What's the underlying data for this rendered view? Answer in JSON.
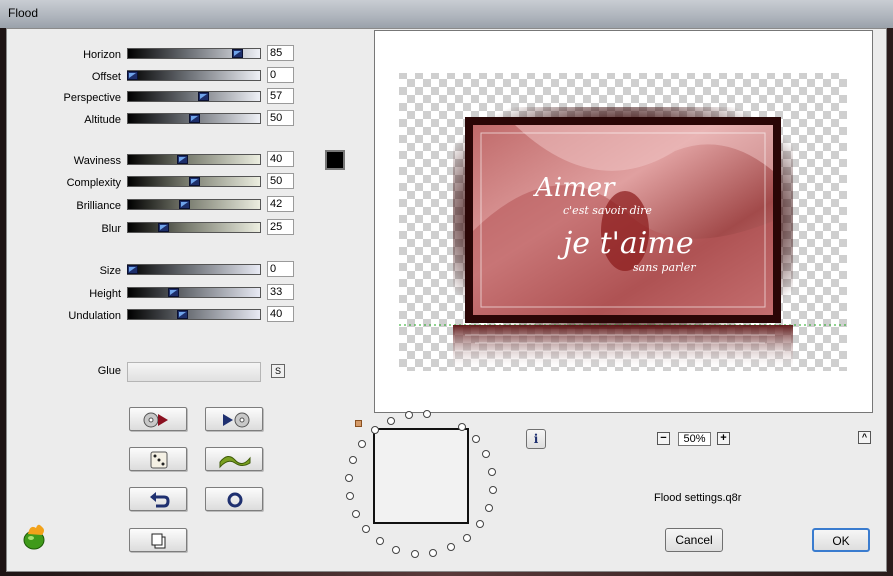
{
  "window": {
    "title": "Flood"
  },
  "sliders": [
    {
      "label": "Horizon",
      "value": "85",
      "level": 0.85
    },
    {
      "label": "Offset",
      "value": "0",
      "level": 0.0
    },
    {
      "label": "Perspective",
      "value": "57",
      "level": 0.57
    },
    {
      "label": "Altitude",
      "value": "50",
      "level": 0.5
    },
    {
      "label": "Waviness",
      "value": "40",
      "level": 0.4
    },
    {
      "label": "Complexity",
      "value": "50",
      "level": 0.5
    },
    {
      "label": "Brilliance",
      "value": "42",
      "level": 0.42
    },
    {
      "label": "Blur",
      "value": "25",
      "level": 0.25
    },
    {
      "label": "Size",
      "value": "0",
      "level": 0.0
    },
    {
      "label": "Height",
      "value": "33",
      "level": 0.33
    },
    {
      "label": "Undulation",
      "value": "40",
      "level": 0.4
    }
  ],
  "colors": {
    "flood_color": "#000000"
  },
  "glue": {
    "label": "Glue",
    "value": ""
  },
  "icon_buttons": [
    {
      "name": "play-from-start",
      "icon": "cd-play-icon"
    },
    {
      "name": "play-to-end",
      "icon": "play-cd-icon"
    },
    {
      "name": "randomize",
      "icon": "dice-icon"
    },
    {
      "name": "wave-preset",
      "icon": "wave-icon"
    },
    {
      "name": "undo",
      "icon": "undo-icon"
    },
    {
      "name": "reset",
      "icon": "ring-icon"
    },
    {
      "name": "copy",
      "icon": "copy-icon"
    }
  ],
  "preview": {
    "text_line1": "Aimer",
    "text_line2": "c'est savoir dire",
    "text_line3": "je t'aime",
    "text_line4": "sans parler"
  },
  "zoom": {
    "value": "50%"
  },
  "settings_file": "Flood settings.q8r",
  "buttons": {
    "cancel": "Cancel",
    "ok": "OK"
  }
}
